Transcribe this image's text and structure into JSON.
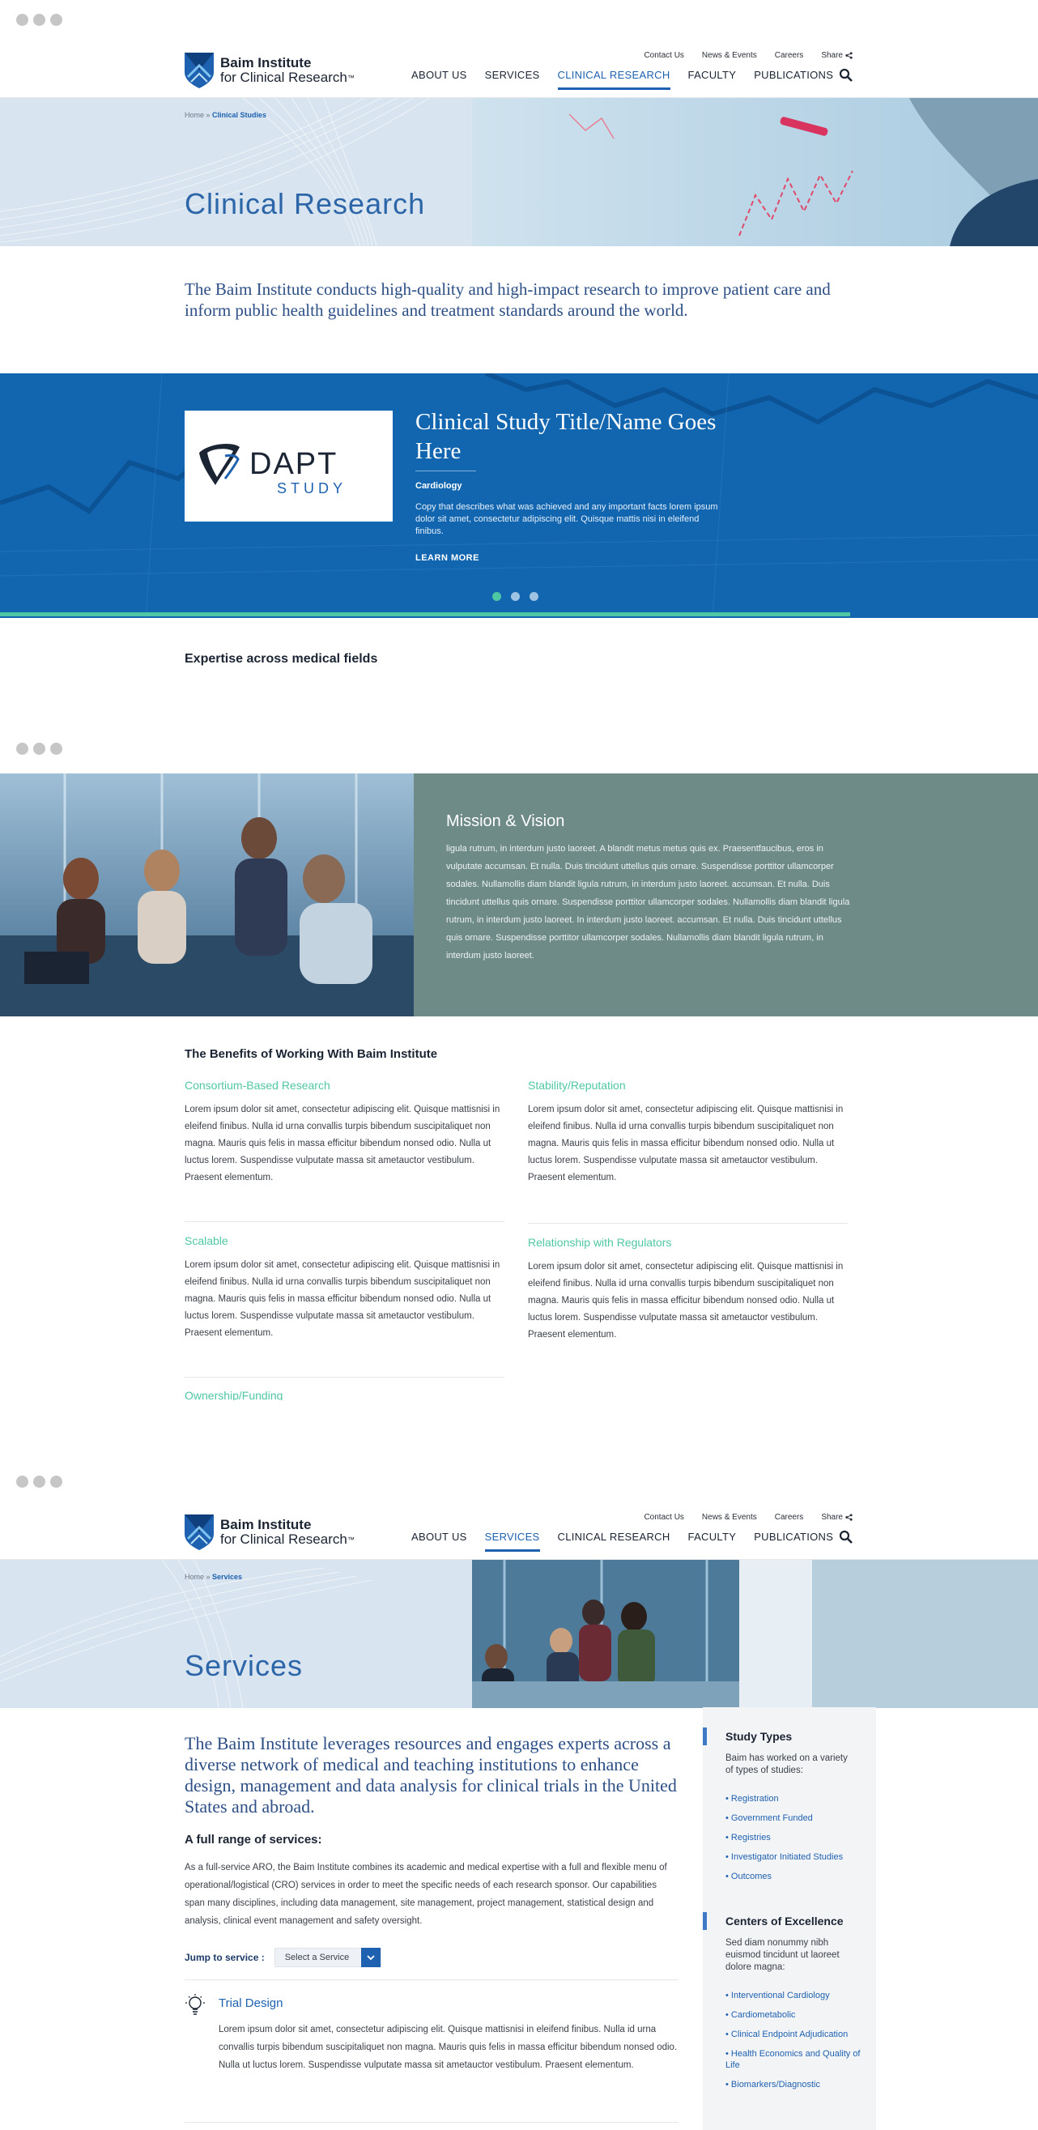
{
  "nav": {
    "logo_line1": "Baim Institute",
    "logo_line2": "for Clinical Research",
    "logo_tm": "™",
    "utility": [
      "Contact Us",
      "News & Events",
      "Careers",
      "Share"
    ],
    "items": [
      "ABOUT US",
      "SERVICES",
      "CLINICAL RESEARCH",
      "FACULTY",
      "PUBLICATIONS"
    ]
  },
  "page1": {
    "breadcrumb_home": "Home",
    "breadcrumb_sep": " » ",
    "breadcrumb_current": "Clinical Studies",
    "hero_title": "Clinical Research",
    "intro": "The Baim Institute conducts high-quality and high-impact research to improve patient care and inform public health guidelines and treatment standards around the world.",
    "carousel": {
      "logo_word": "DAPT",
      "logo_sub": "STUDY",
      "title": "Clinical Study Title/Name Goes Here",
      "category": "Cardiology",
      "copy": "Copy that describes what was achieved and any important facts lorem ipsum dolor sit amet, consectetur adipiscing elit. Quisque mattis nisi in eleifend finibus.",
      "cta": "LEARN MORE"
    },
    "expertise_heading": "Expertise across medical fields"
  },
  "page2": {
    "mission_title": "Mission & Vision",
    "mission_text": "ligula rutrum, in interdum justo laoreet. A blandit metus metus quis ex. Praesentfaucibus, eros in vulputate accumsan. Et nulla. Duis tincidunt uttellus quis ornare. Suspendisse porttitor ullamcorper sodales. Nullamollis diam blandit ligula rutrum, in interdum justo laoreet. accumsan. Et nulla. Duis tincidunt uttellus quis ornare. Suspendisse porttitor ullamcorper sodales. Nullamollis diam blandit ligula rutrum, in interdum justo laoreet. In interdum justo laoreet. accumsan. Et nulla. Duis tincidunt uttellus quis ornare. Suspendisse porttitor ullamcorper sodales. Nullamollis diam blandit ligula rutrum, in interdum justo laoreet.",
    "benefits_heading": "The Benefits of Working With Baim Institute",
    "benefits": [
      {
        "title": "Consortium-Based Research",
        "text": "Lorem ipsum dolor sit amet, consectetur adipiscing elit. Quisque mattisnisi in eleifend finibus. Nulla id urna convallis turpis bibendum suscipitaliquet non magna. Mauris quis felis in massa efficitur bibendum nonsed odio. Nulla ut luctus lorem. Suspendisse vulputate massa sit ametauctor vestibulum. Praesent elementum."
      },
      {
        "title": "Stability/Reputation",
        "text": "Lorem ipsum dolor sit amet, consectetur adipiscing elit. Quisque mattisnisi in eleifend finibus. Nulla id urna convallis turpis bibendum suscipitaliquet non magna. Mauris quis felis in massa efficitur bibendum nonsed odio. Nulla ut luctus lorem. Suspendisse vulputate massa sit ametauctor vestibulum. Praesent elementum."
      },
      {
        "title": "Scalable",
        "text": "Lorem ipsum dolor sit amet, consectetur adipiscing elit. Quisque mattisnisi in eleifend finibus. Nulla id urna convallis turpis bibendum suscipitaliquet non magna. Mauris quis felis in massa efficitur bibendum nonsed odio. Nulla ut luctus lorem. Suspendisse vulputate massa sit ametauctor vestibulum. Praesent elementum."
      },
      {
        "title": "Relationship with Regulators",
        "text": "Lorem ipsum dolor sit amet, consectetur adipiscing elit. Quisque mattisnisi in eleifend finibus. Nulla id urna convallis turpis bibendum suscipitaliquet non magna. Mauris quis felis in massa efficitur bibendum nonsed odio. Nulla ut luctus lorem. Suspendisse vulputate massa sit ametauctor vestibulum. Praesent elementum."
      }
    ],
    "partial_heading": "Ownership/Funding"
  },
  "page3": {
    "breadcrumb_home": "Home",
    "breadcrumb_sep": " » ",
    "breadcrumb_current": "Services",
    "hero_title": "Services",
    "intro": "The Baim Institute leverages resources and engages experts across a diverse network of medical and teaching institutions to enhance design, management and data analysis for clinical trials in the United States and abroad.",
    "subheading": "A full range of services:",
    "body": "As a full-service ARO, the Baim Institute combines its academic and medical expertise with a full and flexible menu of operational/logistical (CRO) services in order to meet the specific needs of each research sponsor. Our capabilities span many disciplines, including data management, site management, project management, statistical design and analysis, clinical event management and safety oversight.",
    "jump_label": "Jump to service :",
    "select_value": "Select a Service",
    "service_title": "Trial Design",
    "service_text": "Lorem ipsum dolor sit amet, consectetur adipiscing elit. Quisque mattisnisi in eleifend finibus. Nulla id urna convallis turpis bibendum suscipitaliquet non magna. Mauris quis felis in massa efficitur bibendum nonsed odio. Nulla ut luctus lorem. Suspendisse vulputate massa sit ametauctor vestibulum. Praesent elementum.",
    "sidebar": {
      "study_types_title": "Study Types",
      "study_types_desc": "Baim has worked on a variety of types of studies:",
      "study_types": [
        "• Registration",
        "• Government Funded",
        "• Registries",
        "• Investigator Initiated Studies",
        "• Outcomes"
      ],
      "coe_title": "Centers of Excellence",
      "coe_desc": "Sed diam nonummy nibh euismod tincidunt ut laoreet dolore magna:",
      "coe": [
        "• Interventional Cardiology",
        "• Cardiometabolic",
        "• Clinical Endpoint Adjudication",
        "• Health Economics and Quality of Life",
        "• Biomarkers/Diagnostic"
      ]
    }
  },
  "colors": {
    "brand_blue": "#1e61b0",
    "heading_blue": "#2d66a8",
    "accent_green": "#4fc7a2",
    "mission_panel": "#6e8b88",
    "carousel_bg": "#1266b0"
  }
}
